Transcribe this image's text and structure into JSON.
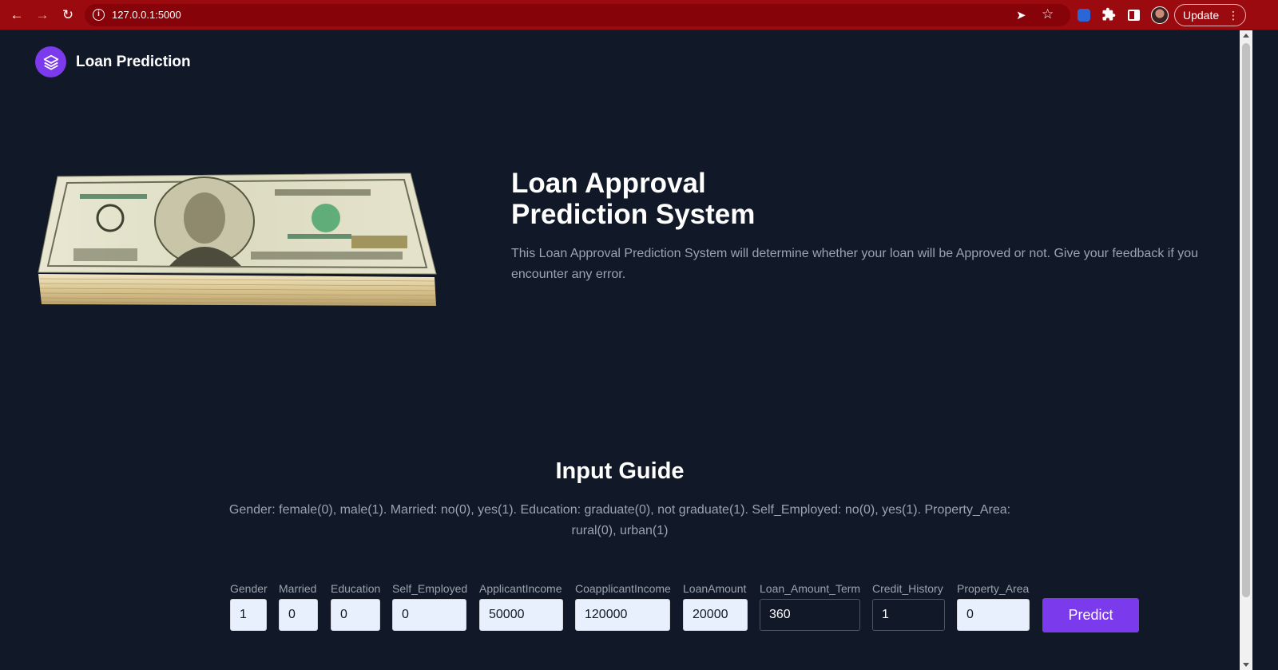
{
  "browser": {
    "url": "127.0.0.1:5000",
    "update_label": "Update"
  },
  "navbar": {
    "brand": "Loan Prediction"
  },
  "hero": {
    "title_line1": "Loan Approval",
    "title_line2": "Prediction System",
    "description": "This Loan Approval Prediction System will determine whether your loan will be Approved or not. Give your feedback if you encounter any error."
  },
  "guide": {
    "title": "Input Guide",
    "text": "Gender: female(0), male(1). Married: no(0), yes(1). Education: graduate(0), not graduate(1). Self_Employed: no(0), yes(1). Property_Area: rural(0), urban(1)"
  },
  "form": {
    "fields": [
      {
        "label": "Gender",
        "value": "1"
      },
      {
        "label": "Married",
        "value": "0"
      },
      {
        "label": "Education",
        "value": "0"
      },
      {
        "label": "Self_Employed",
        "value": "0"
      },
      {
        "label": "ApplicantIncome",
        "value": "50000"
      },
      {
        "label": "CoapplicantIncome",
        "value": "120000"
      },
      {
        "label": "LoanAmount",
        "value": "20000"
      },
      {
        "label": "Loan_Amount_Term",
        "value": "360"
      },
      {
        "label": "Credit_History",
        "value": "1"
      },
      {
        "label": "Property_Area",
        "value": "0"
      }
    ],
    "submit_label": "Predict"
  },
  "colors": {
    "browser_frame": "#9b0a0f",
    "page_background": "#111827",
    "accent": "#7c3aed",
    "autofill_input": "#e8f0fe"
  },
  "icons": {
    "browser": [
      "back-arrow-icon",
      "forward-arrow-icon",
      "reload-icon",
      "info-icon",
      "send-icon",
      "star-icon",
      "extension-icon",
      "puzzle-icon",
      "side-panel-icon",
      "profile-avatar",
      "more-vert-icon"
    ],
    "brand_logo": "stack-layers-icon",
    "hero_image": "dollar-bills-stack"
  }
}
